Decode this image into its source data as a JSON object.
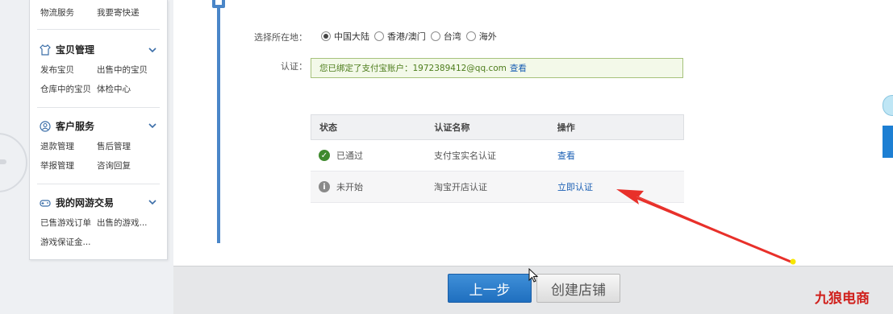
{
  "sidebar": {
    "top_row": [
      "物流服务",
      "我要寄快递"
    ],
    "groups": [
      {
        "title": "宝贝管理",
        "icon": "shirt-icon",
        "rows": [
          [
            "发布宝贝",
            "出售中的宝贝"
          ],
          [
            "仓库中的宝贝",
            "体检中心"
          ]
        ]
      },
      {
        "title": "客户服务",
        "icon": "user-icon",
        "rows": [
          [
            "退款管理",
            "售后管理"
          ],
          [
            "举报管理",
            "咨询回复"
          ]
        ]
      },
      {
        "title": "我的网游交易",
        "icon": "gamepad-icon",
        "rows": [
          [
            "已售游戏订单",
            "出售的游戏..."
          ],
          [
            "游戏保证金...",
            ""
          ]
        ]
      }
    ]
  },
  "form": {
    "location_label": "选择所在地：",
    "location_options": [
      "中国大陆",
      "香港/澳门",
      "台湾",
      "海外"
    ],
    "location_selected": "中国大陆",
    "auth_label": "认证：",
    "auth_message": "您已绑定了支付宝账户：1972389412@qq.com",
    "auth_view_link": "查看"
  },
  "table": {
    "headers": [
      "状态",
      "认证名称",
      "操作"
    ],
    "rows": [
      {
        "status": "已通过",
        "status_icon": "check-circle-icon",
        "name": "支付宝实名认证",
        "action": "查看"
      },
      {
        "status": "未开始",
        "status_icon": "info-circle-icon",
        "name": "淘宝开店认证",
        "action": "立即认证"
      }
    ]
  },
  "buttons": {
    "prev": "上一步",
    "create": "创建店铺"
  },
  "watermark": "九狼电商",
  "colors": {
    "accent": "#1f6fbf",
    "success_bg": "#f3f9e9",
    "annotation": "#e8302a"
  }
}
